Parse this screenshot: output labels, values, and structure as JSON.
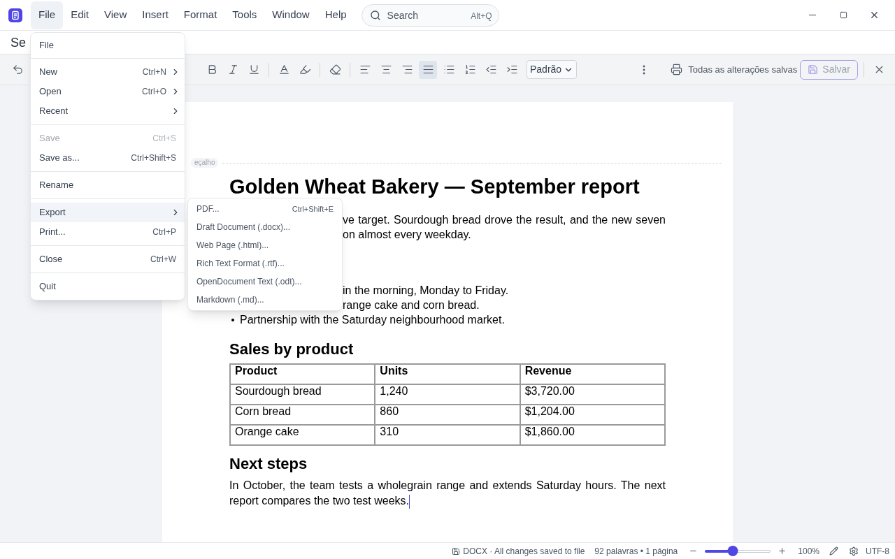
{
  "menu_bar": {
    "items": [
      {
        "label": "File",
        "selected": true
      },
      {
        "label": "Edit",
        "selected": false
      },
      {
        "label": "View",
        "selected": false
      },
      {
        "label": "Insert",
        "selected": false
      },
      {
        "label": "Format",
        "selected": false
      },
      {
        "label": "Tools",
        "selected": false
      },
      {
        "label": "Window",
        "selected": false
      },
      {
        "label": "Help",
        "selected": false
      }
    ],
    "search": {
      "placeholder": "Search",
      "shortcut": "Alt+Q"
    }
  },
  "document_title": "Se",
  "toolbar": {
    "alignment": [
      {
        "selected": false
      },
      {
        "selected": false
      },
      {
        "selected": false
      },
      {
        "selected": true
      }
    ],
    "style_select": "Padrão",
    "save_status": "Todas as alterações salvas",
    "save_button": {
      "label": "Salvar",
      "disabled": true
    }
  },
  "file_menu": {
    "title": "File",
    "groups": [
      [
        {
          "label": "New",
          "shortcut": "Ctrl+N",
          "submenu": true,
          "disabled": false,
          "selected": false
        },
        {
          "label": "Open",
          "shortcut": "Ctrl+O",
          "submenu": true,
          "disabled": false,
          "selected": false
        },
        {
          "label": "Recent",
          "submenu": true,
          "disabled": false,
          "selected": false
        }
      ],
      [
        {
          "label": "Save",
          "shortcut": "Ctrl+S",
          "submenu": false,
          "disabled": true,
          "selected": false
        },
        {
          "label": "Save as...",
          "shortcut": "Ctrl+Shift+S",
          "submenu": false,
          "disabled": false,
          "selected": false
        }
      ],
      [
        {
          "label": "Rename",
          "submenu": false,
          "disabled": false,
          "selected": false
        }
      ],
      [
        {
          "label": "Export",
          "submenu": true,
          "disabled": false,
          "selected": true
        },
        {
          "label": "Print...",
          "shortcut": "Ctrl+P",
          "submenu": false,
          "disabled": false,
          "selected": false
        }
      ],
      [
        {
          "label": "Close",
          "shortcut": "Ctrl+W",
          "submenu": false,
          "disabled": false,
          "selected": false
        }
      ],
      [
        {
          "label": "Quit",
          "submenu": false,
          "disabled": false,
          "selected": false
        }
      ]
    ]
  },
  "export_menu": {
    "items": [
      {
        "label": "PDF...",
        "shortcut": "Ctrl+Shift+E"
      },
      {
        "label": "Draft Document (.docx)..."
      },
      {
        "label": "Web Page (.html)..."
      },
      {
        "label": "Rich Text Format (.rtf)..."
      },
      {
        "label": "OpenDocument Text (.odt)..."
      },
      {
        "label": "Markdown (.md)..."
      }
    ]
  },
  "document": {
    "header_tag": "eçalho",
    "title": "Golden Wheat Bakery — September report",
    "intro_lines": [
      "ve target. Sourdough bread drove the result, and the new seven",
      "on almost every weekday."
    ],
    "bullets": [
      {
        "text": "in the morning, Monday to Friday.",
        "marker": false
      },
      {
        "text": "range cake and corn bread.",
        "marker": false
      },
      {
        "text": "Partnership with the Saturday neighbourhood market.",
        "marker": true
      }
    ],
    "sales_heading": "Sales by product",
    "table": {
      "columns": [
        "Product",
        "Units",
        "Revenue"
      ],
      "rows": [
        [
          "Sourdough bread",
          "1,240",
          "$3,720.00"
        ],
        [
          "Corn bread",
          "860",
          "$1,204.00"
        ],
        [
          "Orange cake",
          "310",
          "$1,860.00"
        ]
      ]
    },
    "next_heading": "Next steps",
    "next_paragraph": "In October, the team tests a wholegrain range and extends Saturday hours. The next report compares the two test weeks."
  },
  "status_bar": {
    "file_status": "DOCX · All changes saved to file",
    "counts": "92 palavras • 1 página",
    "zoom": {
      "level": 0.42,
      "reading": "100%"
    },
    "encoding": "UTF-8"
  }
}
